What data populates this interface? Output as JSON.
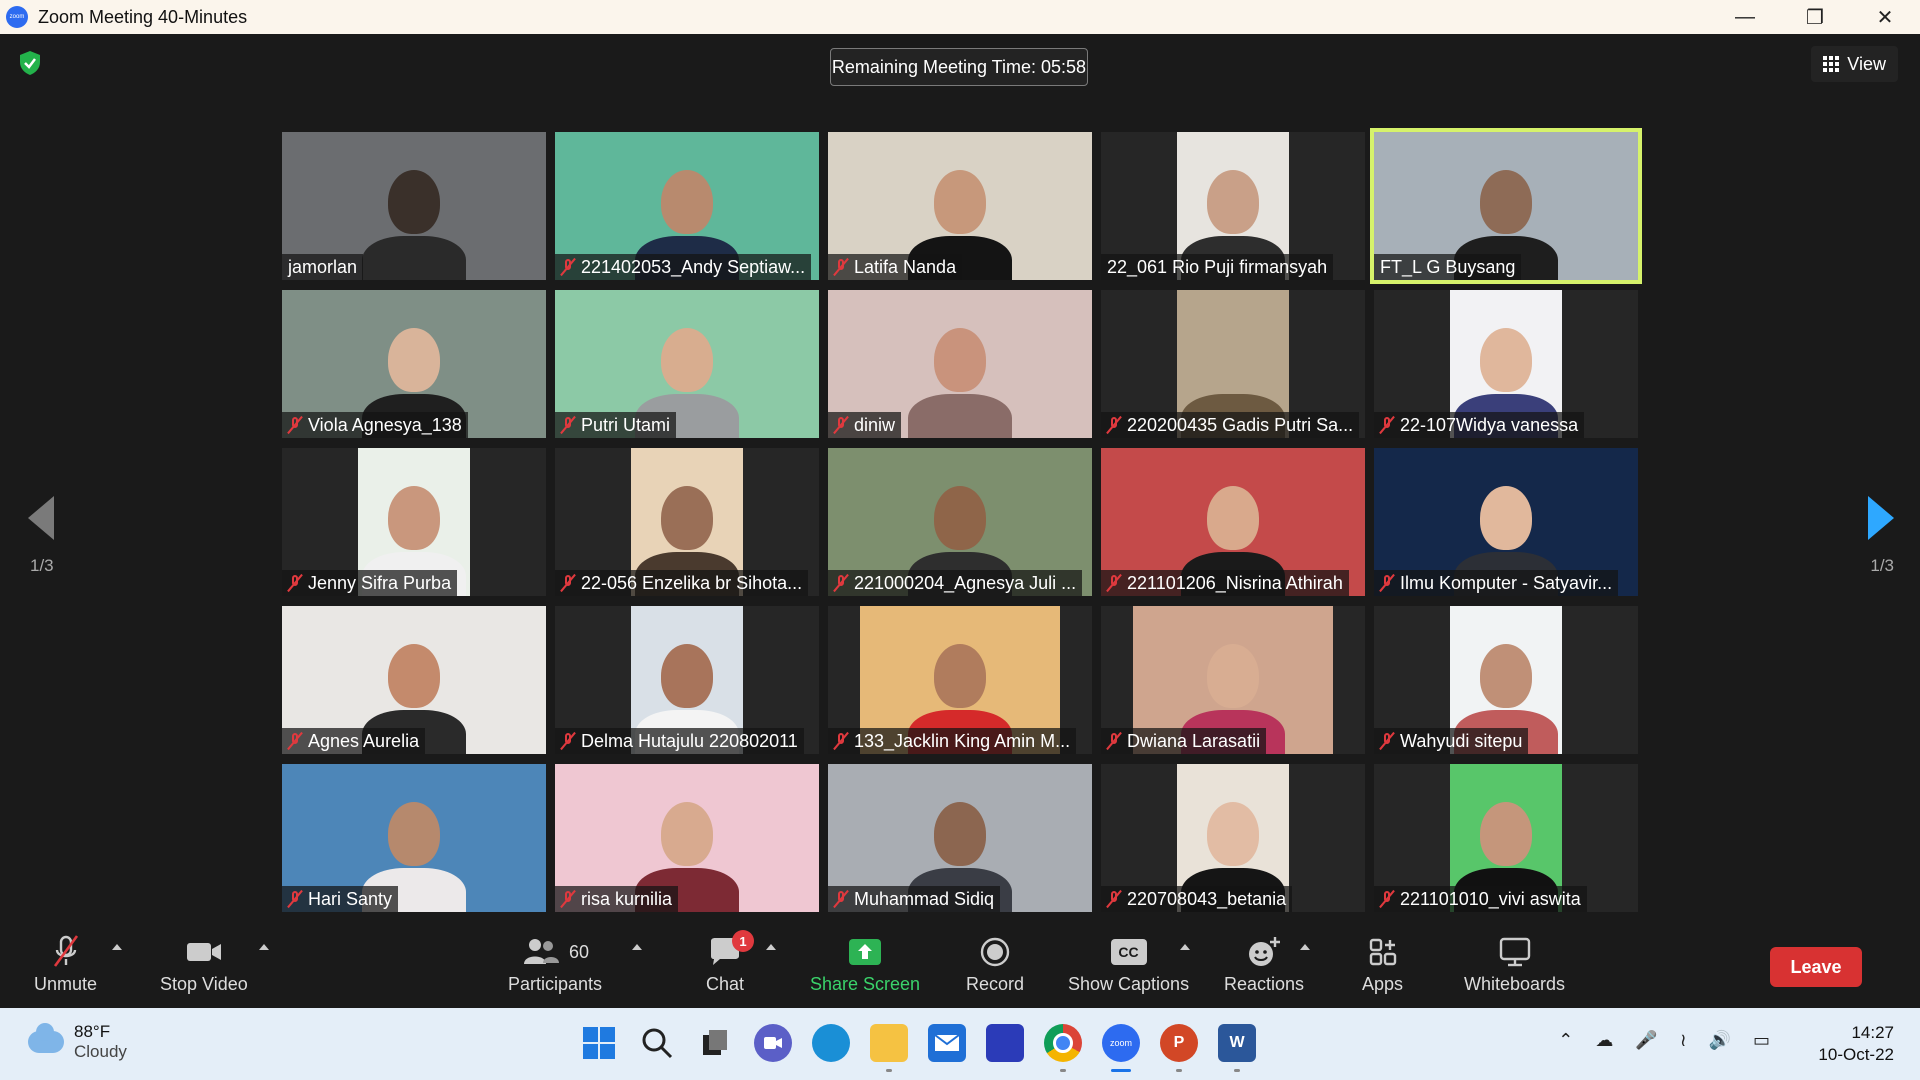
{
  "window": {
    "title": "Zoom Meeting 40-Minutes",
    "app_icon_label": "zoom"
  },
  "meeting": {
    "remaining_time": "Remaining Meeting Time: 05:58",
    "view_label": "View",
    "page_left": "1/3",
    "page_right": "1/3"
  },
  "participants_grid": [
    {
      "name": "jamorlan",
      "muted": false,
      "active": false
    },
    {
      "name": "221402053_Andy Septiaw...",
      "muted": true,
      "active": false
    },
    {
      "name": "Latifa Nanda",
      "muted": true,
      "active": false
    },
    {
      "name": "22_061 Rio Puji firmansyah",
      "muted": false,
      "active": false
    },
    {
      "name": "FT_L G Buysang",
      "muted": false,
      "active": true
    },
    {
      "name": "Viola Agnesya_138",
      "muted": true,
      "active": false
    },
    {
      "name": "Putri Utami",
      "muted": true,
      "active": false
    },
    {
      "name": "diniw",
      "muted": true,
      "active": false
    },
    {
      "name": "220200435 Gadis Putri Sa...",
      "muted": true,
      "active": false
    },
    {
      "name": "22-107Widya vanessa",
      "muted": true,
      "active": false
    },
    {
      "name": "Jenny Sifra Purba",
      "muted": true,
      "active": false
    },
    {
      "name": "22-056 Enzelika br Sihota...",
      "muted": true,
      "active": false
    },
    {
      "name": "221000204_Agnesya Juli ...",
      "muted": true,
      "active": false
    },
    {
      "name": "221101206_Nisrina Athirah",
      "muted": true,
      "active": false
    },
    {
      "name": "Ilmu Komputer - Satyavir...",
      "muted": true,
      "active": false
    },
    {
      "name": "Agnes Aurelia",
      "muted": true,
      "active": false
    },
    {
      "name": "Delma Hutajulu 220802011",
      "muted": true,
      "active": false
    },
    {
      "name": "133_Jacklin King Amin M...",
      "muted": true,
      "active": false
    },
    {
      "name": "Dwiana Larasatii",
      "muted": true,
      "active": false
    },
    {
      "name": "Wahyudi sitepu",
      "muted": true,
      "active": false
    },
    {
      "name": "Hari Santy",
      "muted": true,
      "active": false
    },
    {
      "name": "risa kurnilia",
      "muted": true,
      "active": false
    },
    {
      "name": "Muhammad Sidiq",
      "muted": true,
      "active": false
    },
    {
      "name": "220708043_betania",
      "muted": true,
      "active": false
    },
    {
      "name": "221101010_vivi aswita",
      "muted": true,
      "active": false
    }
  ],
  "toolbar": {
    "unmute": "Unmute",
    "stop_video": "Stop Video",
    "participants": "Participants",
    "participants_count": "60",
    "chat": "Chat",
    "chat_badge": "1",
    "share_screen": "Share Screen",
    "record": "Record",
    "show_captions": "Show Captions",
    "captions_icon": "CC",
    "reactions": "Reactions",
    "apps": "Apps",
    "whiteboards": "Whiteboards",
    "leave": "Leave"
  },
  "taskbar": {
    "temperature": "88°F",
    "condition": "Cloudy",
    "time": "14:27",
    "date": "10-Oct-22",
    "zoom_app_label": "zoom"
  },
  "colors": {
    "accent_green": "#3ad26a",
    "leave_red": "#d83232",
    "active_speaker": "#d6f26b",
    "nav_arrow": "#2ea8ff"
  }
}
